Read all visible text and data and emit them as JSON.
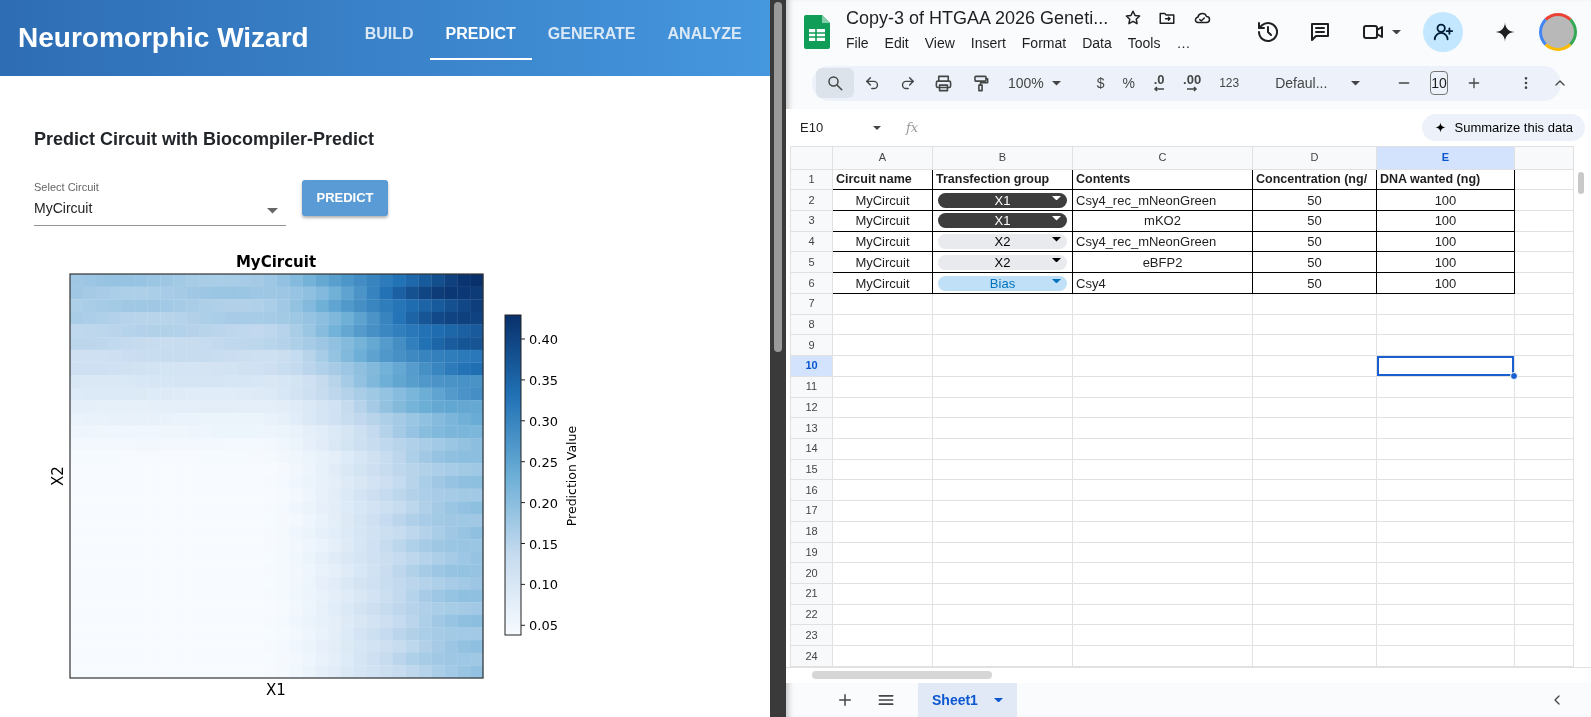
{
  "wizard": {
    "brand": "Neuromorphic Wizard",
    "tabs": [
      {
        "label": "BUILD",
        "selected": false
      },
      {
        "label": "PREDICT",
        "selected": true
      },
      {
        "label": "GENERATE",
        "selected": false
      },
      {
        "label": "ANALYZE",
        "selected": false
      }
    ],
    "heading": "Predict Circuit with Biocompiler-Predict",
    "select": {
      "label": "Select Circuit",
      "value": "MyCircuit"
    },
    "predict_button": "PREDICT",
    "plot": {
      "title": "MyCircuit",
      "xlabel": "X1",
      "ylabel": "X2",
      "colorbar": {
        "label": "Prediction Value",
        "ticks": [
          "0.40",
          "0.35",
          "0.30",
          "0.25",
          "0.20",
          "0.15",
          "0.10",
          "0.05"
        ]
      }
    }
  },
  "sheets": {
    "doc_title": "Copy-3 of HTGAA 2026 Geneti...",
    "menu": [
      "File",
      "Edit",
      "View",
      "Insert",
      "Format",
      "Data",
      "Tools",
      "…"
    ],
    "toolbar": {
      "zoom": "100%",
      "currency": "$",
      "percent": "%",
      "decrease_decimals": ".0",
      "increase_decimals": ".00",
      "number_format": "123",
      "font": "Defaul...",
      "font_size": "10"
    },
    "name_box": "E10",
    "formula_label": "fx",
    "summarize_button": "Summarize this data",
    "grid": {
      "columns": [
        {
          "label": "A",
          "selected": false
        },
        {
          "label": "B",
          "selected": false
        },
        {
          "label": "C",
          "selected": false
        },
        {
          "label": "D",
          "selected": false
        },
        {
          "label": "E",
          "selected": true
        }
      ],
      "rows": [
        {
          "number": "1",
          "selected": false,
          "kind": "header",
          "cells": [
            {
              "kind": "text",
              "text": "Circuit name",
              "centered": false
            },
            {
              "kind": "text",
              "text": "Transfection group",
              "centered": false
            },
            {
              "kind": "text",
              "text": "Contents",
              "centered": false
            },
            {
              "kind": "text",
              "text": "Concentration (ng/",
              "centered": false
            },
            {
              "kind": "text",
              "text": "DNA wanted (ng)",
              "centered": false
            }
          ]
        },
        {
          "number": "2",
          "selected": false,
          "kind": "data",
          "cells": [
            {
              "kind": "text",
              "text": "MyCircuit",
              "centered": true
            },
            {
              "kind": "chip",
              "text": "X1",
              "color": "#3d3d3d"
            },
            {
              "kind": "text",
              "text": "Csy4_rec_mNeonGreen",
              "centered": false
            },
            {
              "kind": "text",
              "text": "50",
              "centered": true
            },
            {
              "kind": "text",
              "text": "100",
              "centered": true
            }
          ]
        },
        {
          "number": "3",
          "selected": false,
          "kind": "data",
          "cells": [
            {
              "kind": "text",
              "text": "MyCircuit",
              "centered": true
            },
            {
              "kind": "chip",
              "text": "X1",
              "color": "#3d3d3d"
            },
            {
              "kind": "text",
              "text": "mKO2",
              "centered": true
            },
            {
              "kind": "text",
              "text": "50",
              "centered": true
            },
            {
              "kind": "text",
              "text": "100",
              "centered": true
            }
          ]
        },
        {
          "number": "4",
          "selected": false,
          "kind": "data",
          "cells": [
            {
              "kind": "text",
              "text": "MyCircuit",
              "centered": true
            },
            {
              "kind": "chip",
              "text": "X2",
              "color": "#e8eaed"
            },
            {
              "kind": "text",
              "text": "Csy4_rec_mNeonGreen",
              "centered": false
            },
            {
              "kind": "text",
              "text": "50",
              "centered": true
            },
            {
              "kind": "text",
              "text": "100",
              "centered": true
            }
          ]
        },
        {
          "number": "5",
          "selected": false,
          "kind": "data",
          "cells": [
            {
              "kind": "text",
              "text": "MyCircuit",
              "centered": true
            },
            {
              "kind": "chip",
              "text": "X2",
              "color": "#e8eaed"
            },
            {
              "kind": "text",
              "text": "eBFP2",
              "centered": true
            },
            {
              "kind": "text",
              "text": "50",
              "centered": true
            },
            {
              "kind": "text",
              "text": "100",
              "centered": true
            }
          ]
        },
        {
          "number": "6",
          "selected": false,
          "kind": "data",
          "cells": [
            {
              "kind": "text",
              "text": "MyCircuit",
              "centered": true
            },
            {
              "kind": "chip",
              "text": "Bias",
              "color": "#bfe0f6"
            },
            {
              "kind": "text",
              "text": "Csy4",
              "centered": false
            },
            {
              "kind": "text",
              "text": "50",
              "centered": true
            },
            {
              "kind": "text",
              "text": "100",
              "centered": true
            }
          ]
        },
        {
          "number": "7",
          "selected": false
        },
        {
          "number": "8",
          "selected": false
        },
        {
          "number": "9",
          "selected": false
        },
        {
          "number": "10",
          "selected": true
        },
        {
          "number": "11",
          "selected": false
        },
        {
          "number": "12",
          "selected": false
        },
        {
          "number": "13",
          "selected": false
        },
        {
          "number": "14",
          "selected": false
        },
        {
          "number": "15",
          "selected": false
        },
        {
          "number": "16",
          "selected": false
        },
        {
          "number": "17",
          "selected": false
        },
        {
          "number": "18",
          "selected": false
        },
        {
          "number": "19",
          "selected": false
        },
        {
          "number": "20",
          "selected": false
        },
        {
          "number": "21",
          "selected": false
        },
        {
          "number": "22",
          "selected": false
        },
        {
          "number": "23",
          "selected": false
        },
        {
          "number": "24",
          "selected": false
        }
      ]
    },
    "sheet_tabs": [
      {
        "label": "Sheet1",
        "selected": true
      }
    ]
  }
}
